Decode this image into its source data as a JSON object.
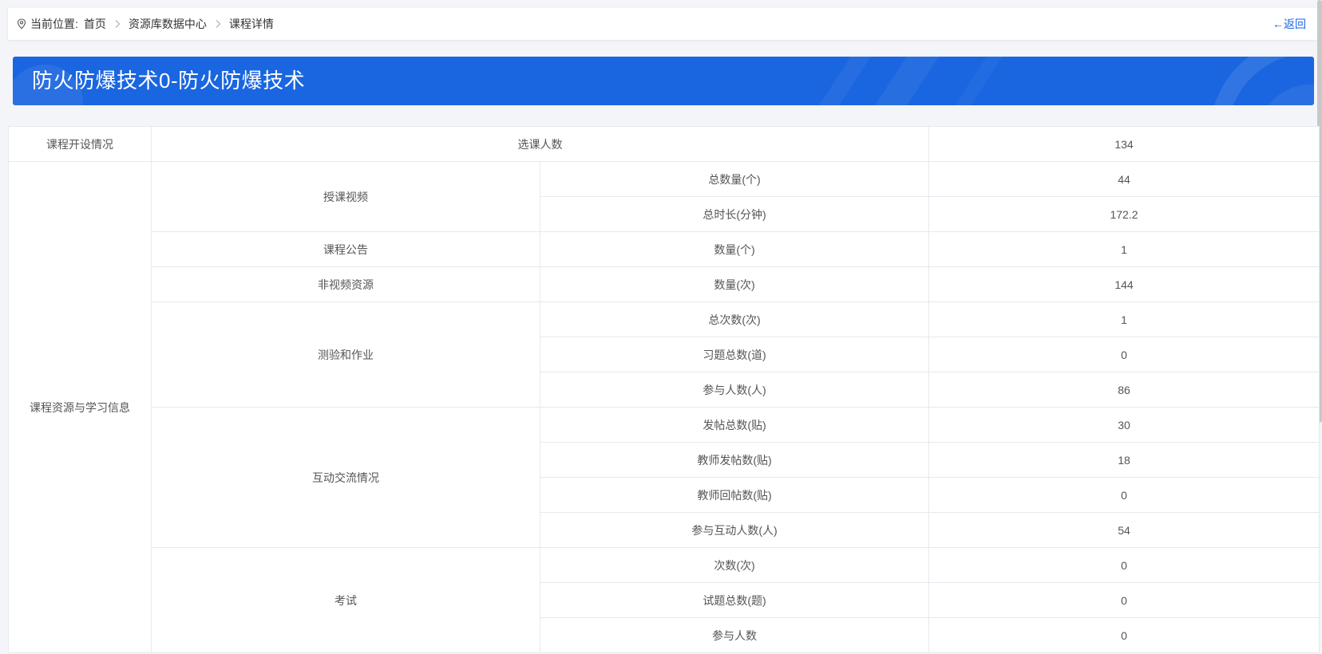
{
  "breadcrumb": {
    "prefix": "当前位置",
    "colon": ":",
    "items": [
      "首页",
      "资源库数据中心",
      "课程详情"
    ]
  },
  "back_label": "←返回",
  "banner": {
    "title": "防火防爆技术0-防火防爆技术",
    "color": "#1a66e0"
  },
  "table": {
    "course_setup": {
      "label": "课程开设情况",
      "metric": "选课人数",
      "value": "134"
    },
    "resources": {
      "label": "课程资源与学习信息",
      "groups": [
        {
          "name": "授课视频",
          "rows": [
            {
              "metric": "总数量(个)",
              "value": "44"
            },
            {
              "metric": "总时长(分钟)",
              "value": "172.2"
            }
          ]
        },
        {
          "name": "课程公告",
          "rows": [
            {
              "metric": "数量(个)",
              "value": "1"
            }
          ]
        },
        {
          "name": "非视频资源",
          "rows": [
            {
              "metric": "数量(次)",
              "value": "144"
            }
          ]
        },
        {
          "name": "测验和作业",
          "rows": [
            {
              "metric": "总次数(次)",
              "value": "1"
            },
            {
              "metric": "习题总数(道)",
              "value": "0"
            },
            {
              "metric": "参与人数(人)",
              "value": "86"
            }
          ]
        },
        {
          "name": "互动交流情况",
          "rows": [
            {
              "metric": "发帖总数(贴)",
              "value": "30"
            },
            {
              "metric": "教师发帖数(贴)",
              "value": "18"
            },
            {
              "metric": "教师回帖数(贴)",
              "value": "0"
            },
            {
              "metric": "参与互动人数(人)",
              "value": "54"
            }
          ]
        },
        {
          "name": "考试",
          "rows": [
            {
              "metric": "次数(次)",
              "value": "0"
            },
            {
              "metric": "试题总数(题)",
              "value": "0"
            },
            {
              "metric": "参与人数",
              "value": "0"
            }
          ]
        }
      ]
    }
  }
}
